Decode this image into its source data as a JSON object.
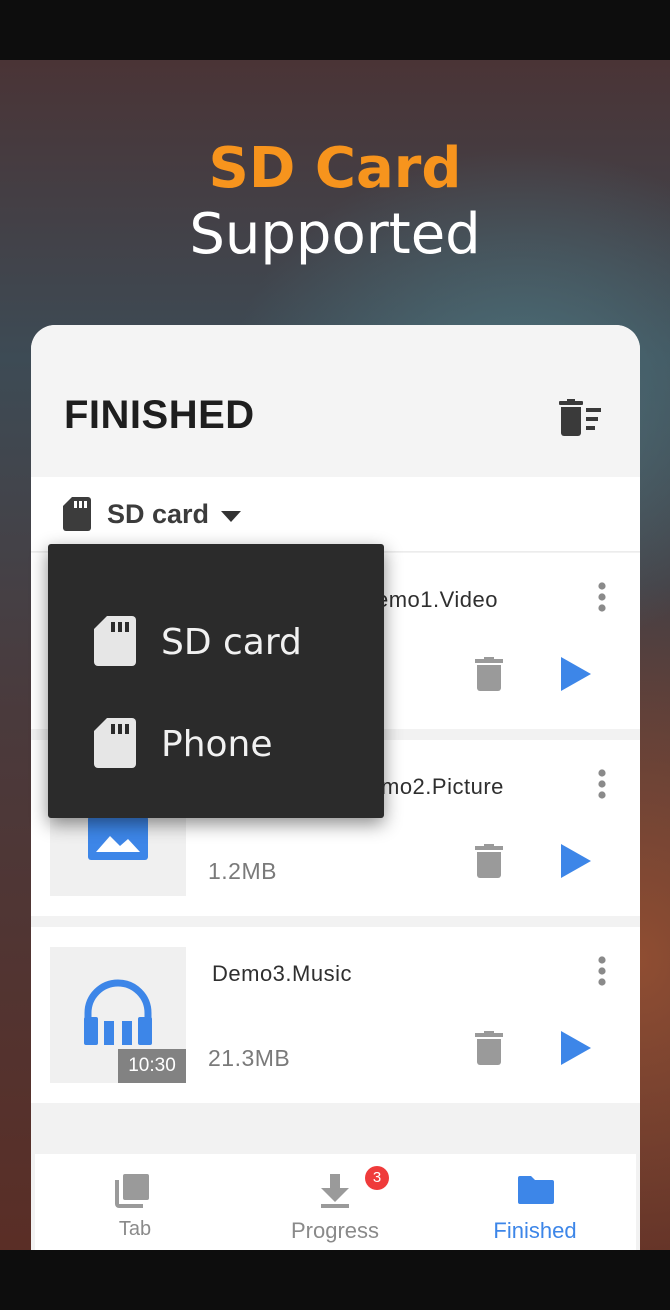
{
  "promo": {
    "line1": "SD Card",
    "line2": "Supported"
  },
  "header": {
    "title": "FINISHED",
    "clear_icon": "delete-all-icon"
  },
  "storage": {
    "selected": "SD card",
    "icon": "sd-card-icon"
  },
  "dropdown": {
    "options": [
      {
        "label": "SD card",
        "icon": "sd-card-icon"
      },
      {
        "label": "Phone",
        "icon": "sd-card-icon"
      }
    ]
  },
  "items": [
    {
      "name": "Demo1.Video",
      "visible_name": "emo1.Video",
      "size": "",
      "type": "video"
    },
    {
      "name": "Demo2.Picture",
      "visible_name": "mo2.Picture",
      "size": "1.2MB",
      "type": "picture"
    },
    {
      "name": "Demo3.Music",
      "visible_name": "Demo3.Music",
      "size": "21.3MB",
      "type": "music",
      "duration": "10:30"
    }
  ],
  "nav": {
    "tab": "Tab",
    "progress": "Progress",
    "progress_badge": "3",
    "finished": "Finished"
  },
  "colors": {
    "accent": "#3d86e8",
    "promo_orange": "#f7941d",
    "badge": "#ef3b3b"
  }
}
